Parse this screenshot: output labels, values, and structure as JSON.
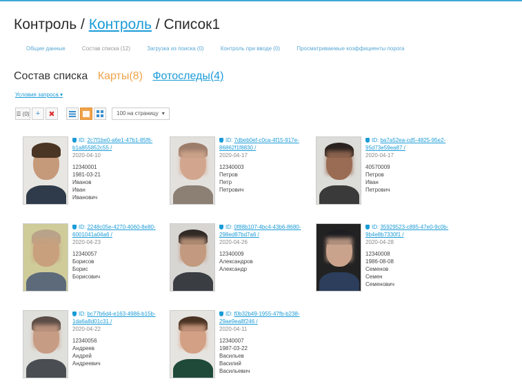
{
  "breadcrumb": {
    "part1": "Контроль /",
    "part2": "Контроль",
    "part3": "/ Список1"
  },
  "subnav": [
    {
      "label": "Общие данные",
      "active": false
    },
    {
      "label": "Состав списка (12)",
      "active": true
    },
    {
      "label": "Загрузка из поиска (0)",
      "active": false
    },
    {
      "label": "Контроль при вводе (0)",
      "active": false
    },
    {
      "label": "Просматриваемые коэффициенты порога",
      "active": false
    }
  ],
  "heading": {
    "title": "Состав списка",
    "cards_label": "Карты",
    "cards_count": "(8)",
    "photos_label": "Фотоследы",
    "photos_count": "(4)"
  },
  "conditions_link": "Условия запроса ▾",
  "toolbar": {
    "select_label": "☰ (0)",
    "add_icon": "+",
    "delete_icon": "✖",
    "per_page": "100 на страницу",
    "per_page_caret": "▾"
  },
  "cards": [
    {
      "id_prefix": "ID:",
      "uid": "2c7f1be0-a6e1-47b1-85f6-b1a855852c55 /",
      "date": "2020-04-10",
      "lines": [
        "12340001",
        "1981-03-21",
        "Иванов",
        "Иван",
        "Иванович"
      ],
      "colors": {
        "bg": "#e8e6e2",
        "skin": "#c59a7a",
        "hair": "#4a3524",
        "body": "#2f3b4a"
      }
    },
    {
      "id_prefix": "ID:",
      "uid": "7dbeb0ef-c0ca-4f15-917e-86862f1f8830 /",
      "date": "2020-04-17",
      "lines": [
        "12340003",
        "Петров",
        "Петр",
        "Петрович"
      ],
      "colors": {
        "bg": "#e3e1dd",
        "skin": "#d2a68e",
        "hair": "#9c7d6a",
        "body": "#8c7f74"
      }
    },
    {
      "id_prefix": "ID:",
      "uid": "ba7a52ea-cd5-4825-95e2-95d73e59ea87 /",
      "date": "2020-04-17",
      "lines": [
        "40570009",
        "Петров",
        "Иван",
        "Петрович"
      ],
      "colors": {
        "bg": "#dcdcd8",
        "skin": "#9a6c54",
        "hair": "#2a2220",
        "body": "#3a3a3a"
      }
    },
    {
      "id_prefix": "ID:",
      "uid": "2248c05e-4270-4060-8e80-6001041a04a6 /",
      "date": "2020-04-23",
      "lines": [
        "12340057",
        "Борисов",
        "Борис",
        "Борисович"
      ],
      "colors": {
        "bg": "#cfcc9a",
        "skin": "#c8a07e",
        "hair": "#b8a38a",
        "body": "#5c6a7a"
      }
    },
    {
      "id_prefix": "ID:",
      "uid": "0f88b107-4bc4-43b6-8680-298ed87bd7a6 /",
      "date": "2020-04-26",
      "lines": [
        "12340009",
        "Александров",
        "Александр"
      ],
      "colors": {
        "bg": "#d7d6d3",
        "skin": "#c39a7f",
        "hair": "#2f2824",
        "body": "#3a3d42"
      }
    },
    {
      "id_prefix": "ID:",
      "uid": "35929523-c895-47e0-9c0b-9b4e8b7330f1 /",
      "date": "2020-04-28",
      "lines": [
        "12340008",
        "1986-08-08",
        "Семенов",
        "Семен",
        "Семенович"
      ],
      "colors": {
        "bg": "#222222",
        "skin": "#caa38d",
        "hair": "#1e1e22",
        "body": "#2c3e5c"
      }
    },
    {
      "id_prefix": "ID:",
      "uid": "bc77b6d4-e163-4986-b15b-1da6a8d01c31 /",
      "date": "2020-04-22",
      "lines": [
        "12340056",
        "Андреев",
        "Андрей",
        "Андреевич"
      ],
      "colors": {
        "bg": "#dfdfdb",
        "skin": "#c79c84",
        "hair": "#5b4c45",
        "body": "#4a4d52"
      }
    },
    {
      "id_prefix": "ID:",
      "uid": "f0b32b49-1955-47fb-b238-29ae9ea8f246 /",
      "date": "2020-04-11",
      "lines": [
        "12340007",
        "1987-03-22",
        "Васильев",
        "Василий",
        "Васильевич"
      ],
      "colors": {
        "bg": "#e6e4e0",
        "skin": "#d3a085",
        "hair": "#4a3323",
        "body": "#1f4a3a"
      }
    }
  ]
}
